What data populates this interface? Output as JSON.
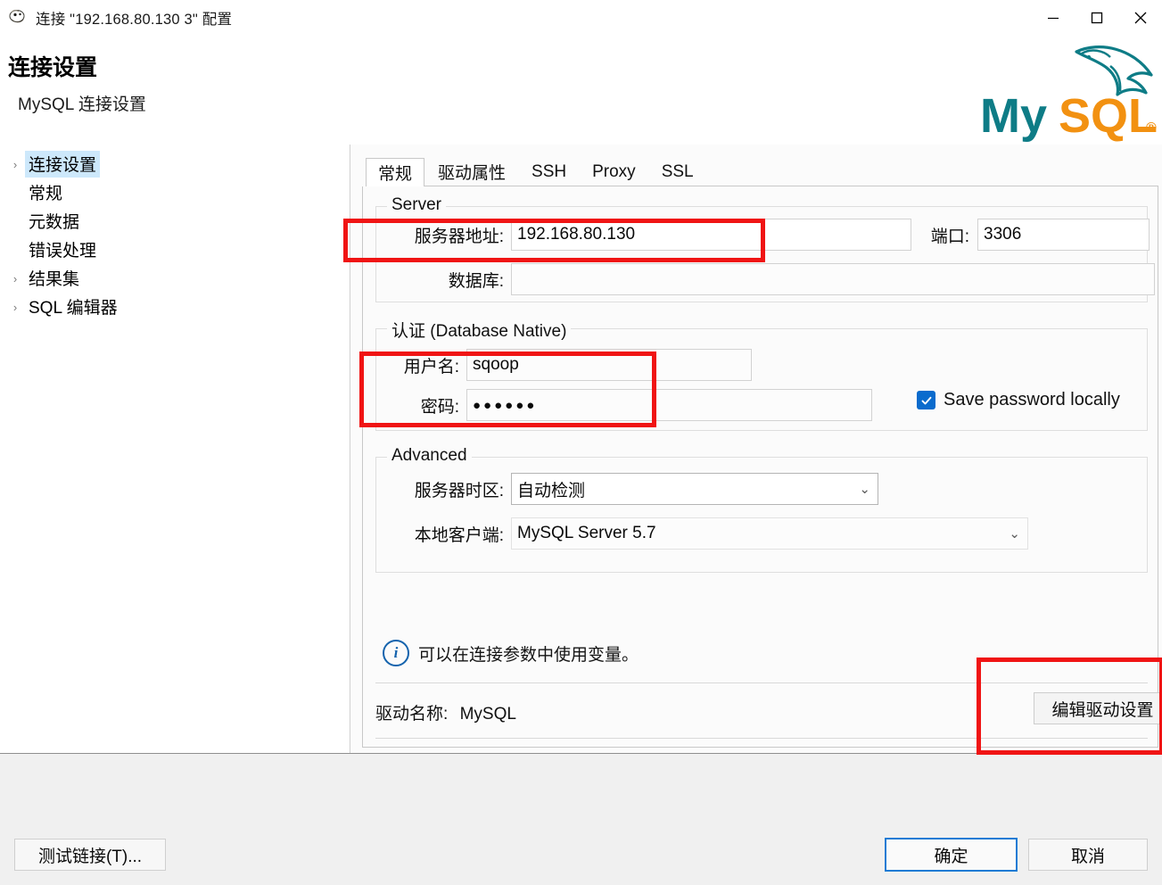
{
  "window": {
    "title": "连接 \"192.168.80.130 3\" 配置",
    "app_icon": "dolphin-app-icon",
    "controls": [
      {
        "name": "minimize",
        "glyph": "—"
      },
      {
        "name": "maximize",
        "glyph": "▢"
      },
      {
        "name": "close",
        "glyph": "✕"
      }
    ]
  },
  "header": {
    "title": "连接设置",
    "subtitle": "MySQL 连接设置",
    "logo_text_primary": "My",
    "logo_text_secondary": "SQL",
    "logo_registered": "®",
    "logo_color_primary": "#0e7c86",
    "logo_color_secondary": "#f29111"
  },
  "sidebar": {
    "items": [
      {
        "label": "连接设置",
        "expandable": true,
        "selected": true
      },
      {
        "label": "常规",
        "expandable": false,
        "selected": false
      },
      {
        "label": "元数据",
        "expandable": false,
        "selected": false
      },
      {
        "label": "错误处理",
        "expandable": false,
        "selected": false
      },
      {
        "label": "结果集",
        "expandable": true,
        "selected": false
      },
      {
        "label": "SQL 编辑器",
        "expandable": true,
        "selected": false
      }
    ],
    "arrow_glyph": "›"
  },
  "tabs": [
    {
      "label": "常规",
      "active": true
    },
    {
      "label": "驱动属性",
      "active": false
    },
    {
      "label": "SSH",
      "active": false
    },
    {
      "label": "Proxy",
      "active": false
    },
    {
      "label": "SSL",
      "active": false
    }
  ],
  "server_group": {
    "title": "Server",
    "host_label": "服务器地址:",
    "host_value": "192.168.80.130",
    "port_label": "端口:",
    "port_value": "3306",
    "database_label": "数据库:",
    "database_value": ""
  },
  "auth_group": {
    "title": "认证 (Database Native)",
    "username_label": "用户名:",
    "username_value": "sqoop",
    "password_label": "密码:",
    "password_value": "●●●●●●",
    "save_password_label": "Save password locally",
    "save_password_checked": true,
    "checkbox_color": "#0a6bcd"
  },
  "advanced_group": {
    "title": "Advanced",
    "timezone_label": "服务器时区:",
    "timezone_value": "自动检测",
    "client_label": "本地客户端:",
    "client_value": "MySQL Server 5.7",
    "chevron_glyph": "⌄"
  },
  "note": {
    "icon": "info-icon",
    "icon_glyph": "i",
    "text": "可以在连接参数中使用变量。"
  },
  "driver": {
    "label": "驱动名称:",
    "value": "MySQL",
    "edit_button": "编辑驱动设置"
  },
  "footer": {
    "test_button": "测试链接(T)...",
    "ok_button": "确定",
    "cancel_button": "取消"
  },
  "annotations": {
    "color": "#f01414",
    "boxes": [
      {
        "name": "host-field-highlight"
      },
      {
        "name": "credentials-highlight"
      },
      {
        "name": "edit-driver-highlight"
      }
    ]
  }
}
